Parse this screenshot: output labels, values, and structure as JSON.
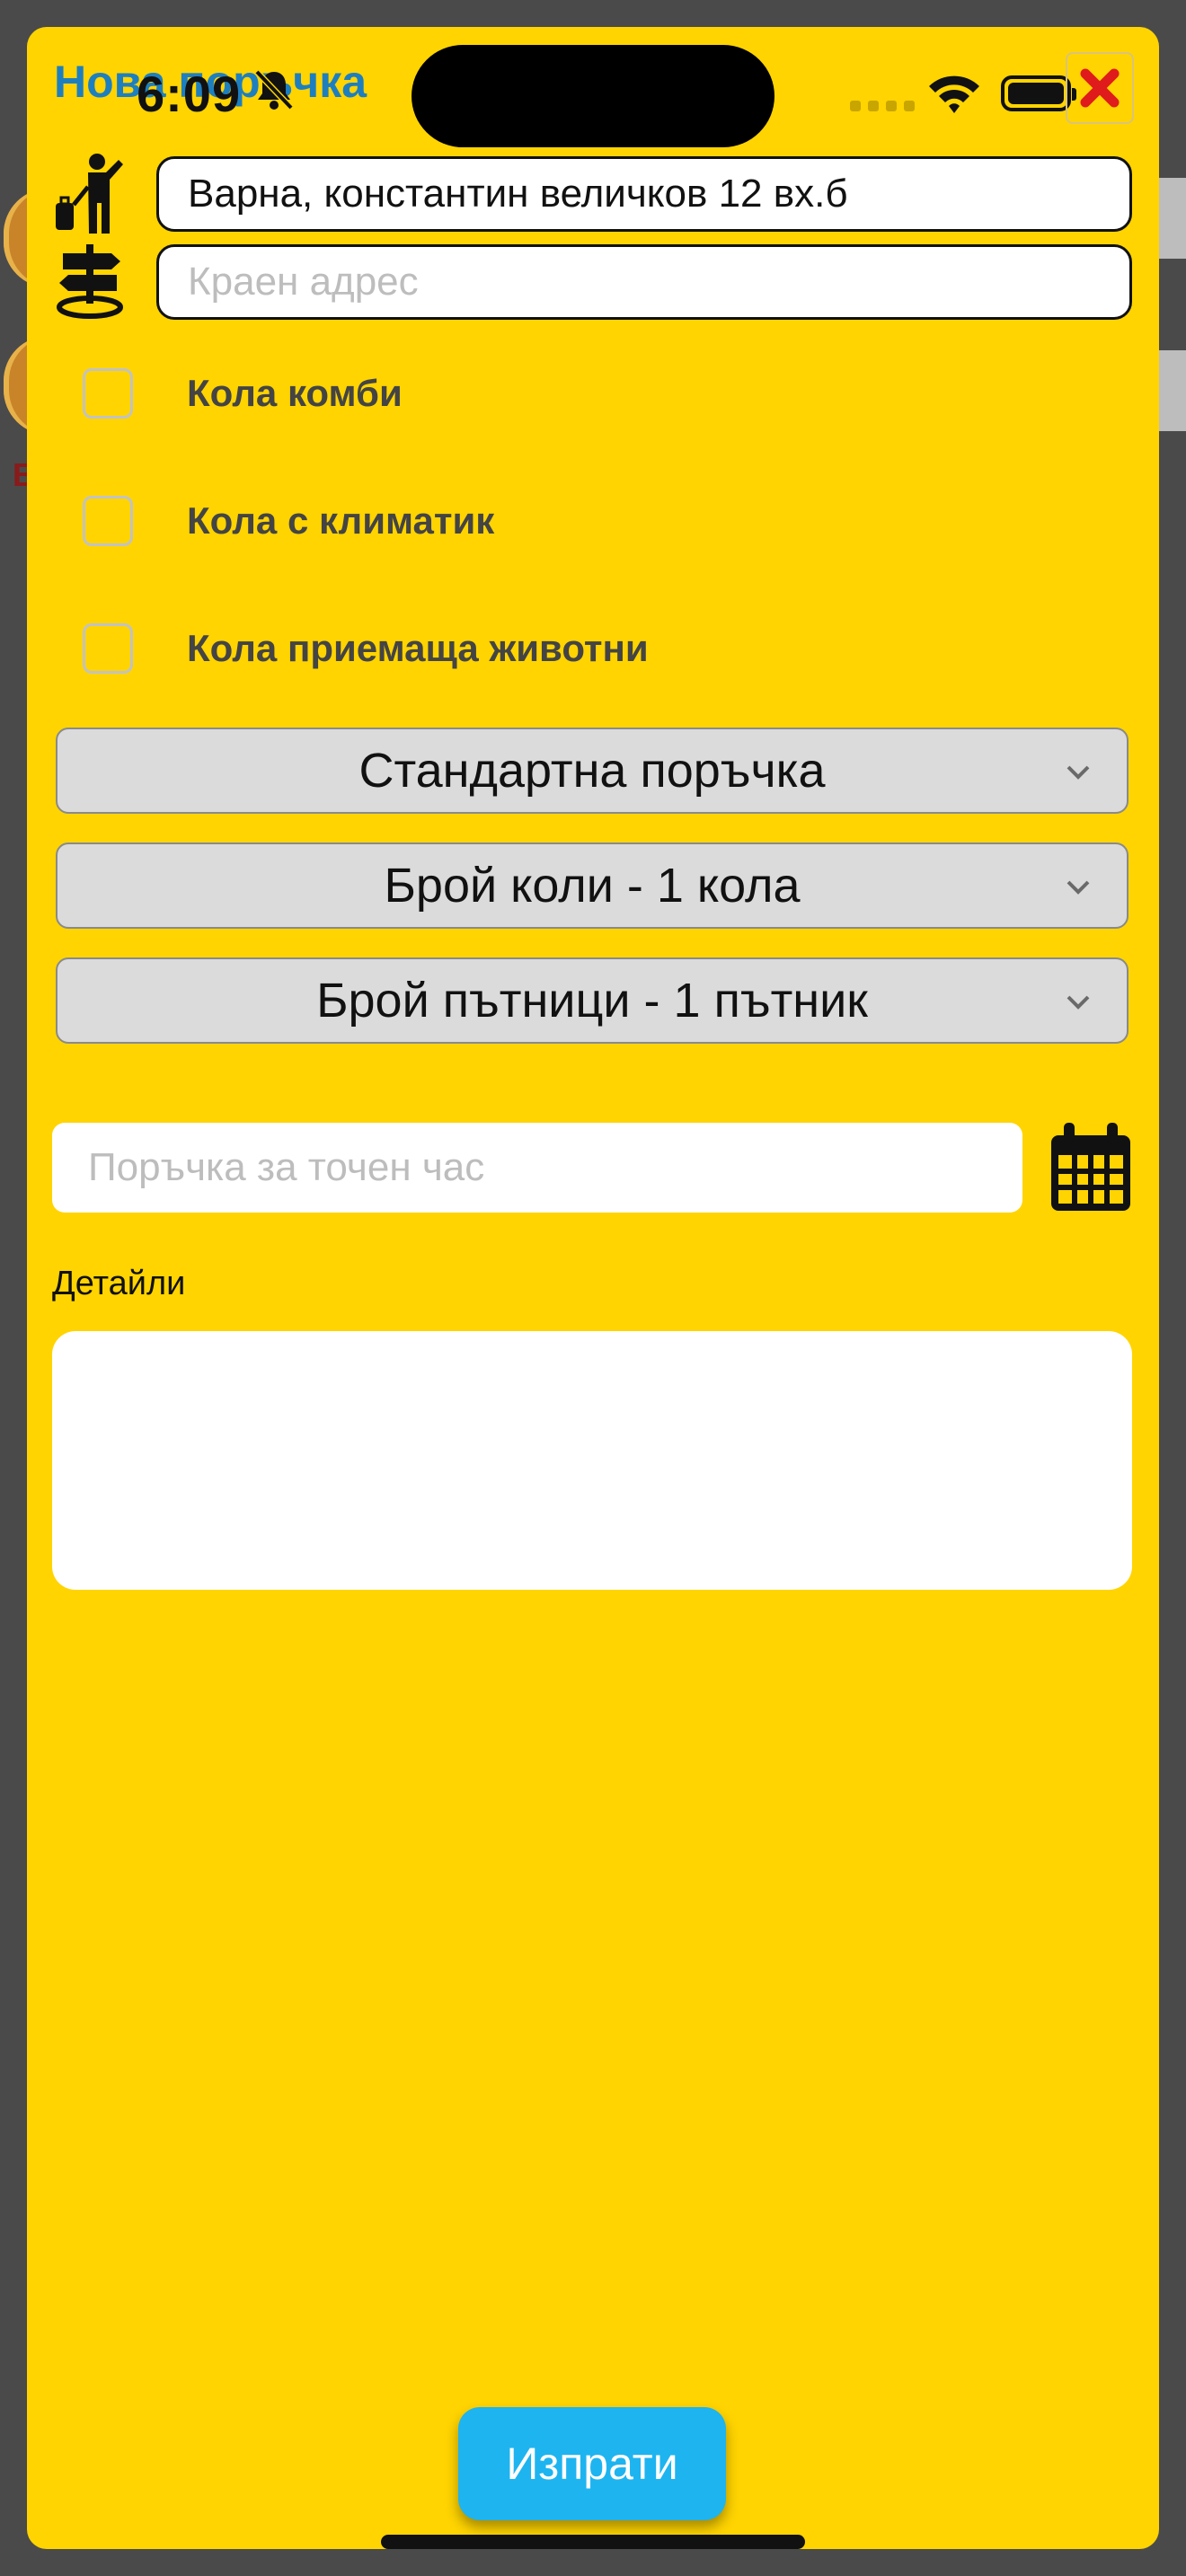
{
  "status_bar": {
    "time": "6:09"
  },
  "header": {
    "title": "Нова поръчка"
  },
  "addresses": {
    "start_value": "Варна, константин величков 12 вх.б",
    "end_placeholder": "Краен адрес"
  },
  "options": [
    {
      "label": "Кола комби",
      "checked": false
    },
    {
      "label": "Кола с климатик",
      "checked": false
    },
    {
      "label": "Кола приемаща животни",
      "checked": false
    }
  ],
  "selects": {
    "order_type": "Стандартна поръчка",
    "cars_count": "Брой коли - 1 кола",
    "passengers_count": "Брой пътници - 1 пътник"
  },
  "scheduled": {
    "placeholder": "Поръчка за точен час"
  },
  "details": {
    "label": "Детайли",
    "value": ""
  },
  "submit": {
    "label": "Изпрати"
  },
  "colors": {
    "sheet": "#FFD400",
    "title": "#1e7fbf",
    "submit": "#1eb4f0",
    "close": "#e01b1b"
  }
}
